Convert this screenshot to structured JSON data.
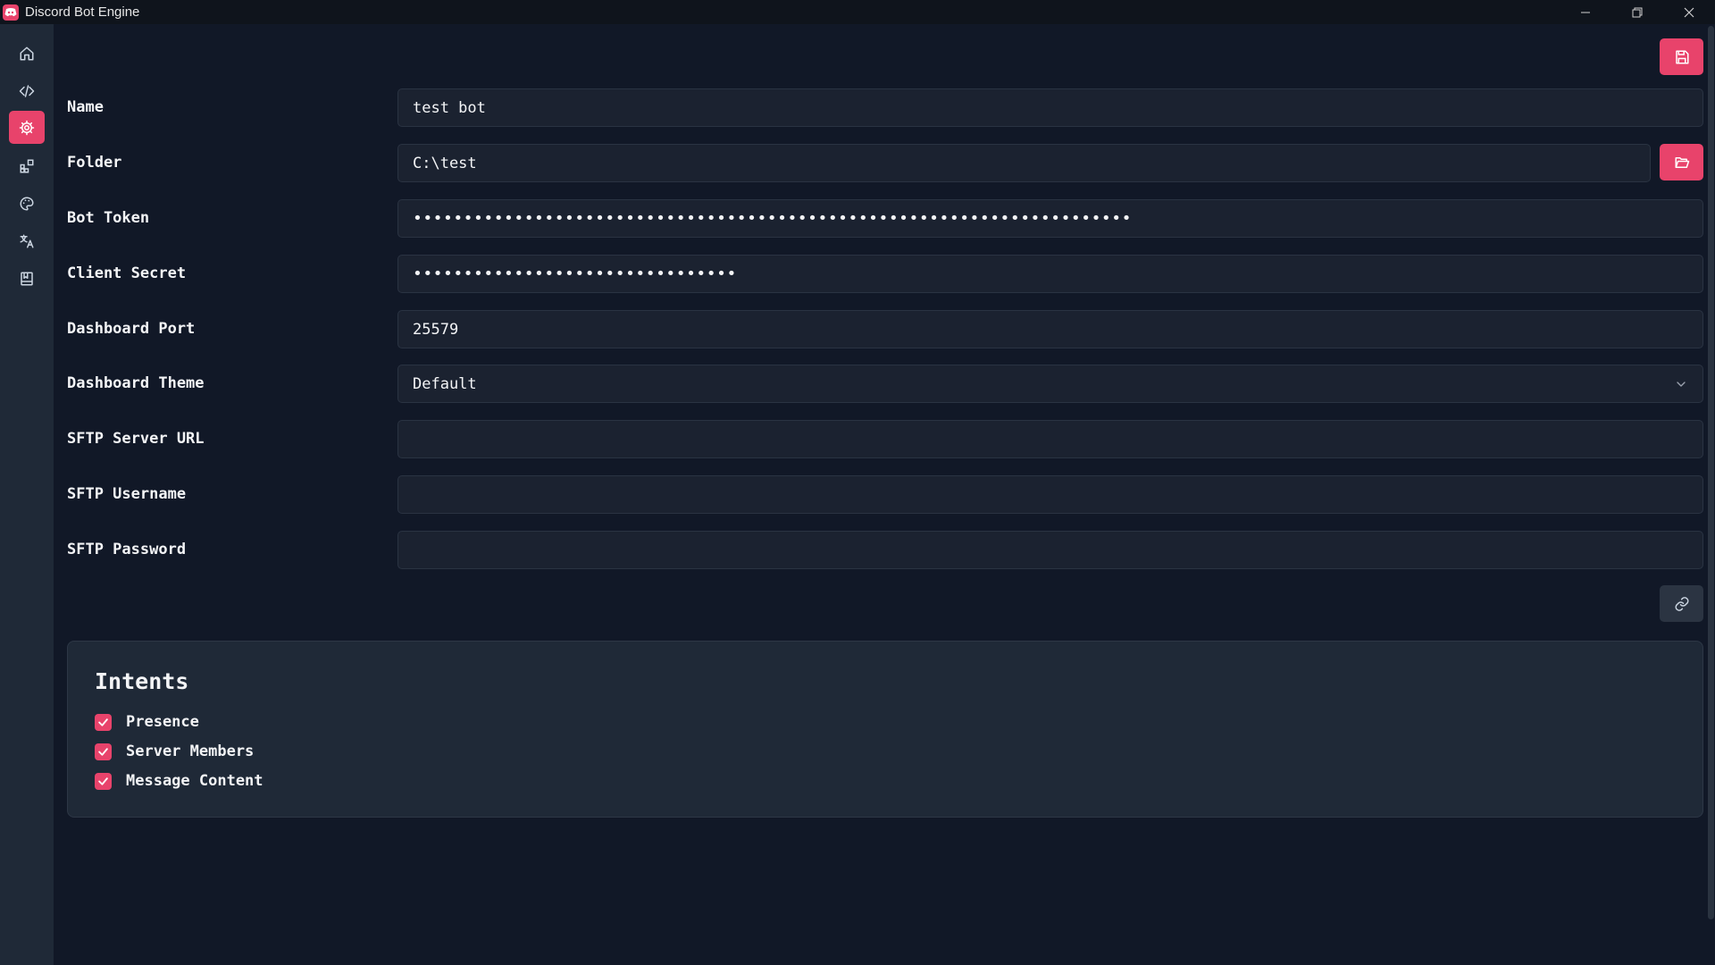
{
  "window": {
    "title": "Discord Bot Engine"
  },
  "sidebar": {
    "items": [
      {
        "icon": "home-icon",
        "active": false
      },
      {
        "icon": "code-icon",
        "active": false
      },
      {
        "icon": "gear-icon",
        "active": true
      },
      {
        "icon": "plugins-icon",
        "active": false
      },
      {
        "icon": "palette-icon",
        "active": false
      },
      {
        "icon": "translate-icon",
        "active": false
      },
      {
        "icon": "book-icon",
        "active": false
      }
    ]
  },
  "toolbar": {
    "save_icon": "save-icon"
  },
  "form": {
    "name": {
      "label": "Name",
      "value": "test bot"
    },
    "folder": {
      "label": "Folder",
      "value": "C:\\test"
    },
    "bot_token": {
      "label": "Bot Token",
      "value": "•••••••••••••••••••••••••••••••••••••••••••••••••••••••••••••••••••••••"
    },
    "client_secret": {
      "label": "Client Secret",
      "value": "••••••••••••••••••••••••••••••••"
    },
    "dashboard_port": {
      "label": "Dashboard Port",
      "value": "25579"
    },
    "dashboard_theme": {
      "label": "Dashboard Theme",
      "value": "Default"
    },
    "sftp_url": {
      "label": "SFTP Server URL",
      "value": ""
    },
    "sftp_username": {
      "label": "SFTP Username",
      "value": ""
    },
    "sftp_password": {
      "label": "SFTP Password",
      "value": ""
    }
  },
  "intents": {
    "title": "Intents",
    "items": [
      {
        "label": "Presence",
        "checked": true
      },
      {
        "label": "Server Members",
        "checked": true
      },
      {
        "label": "Message Content",
        "checked": true
      }
    ]
  },
  "colors": {
    "accent": "#e8436b",
    "background": "#111827",
    "sidebar": "#1f2937",
    "input": "#1b2230"
  }
}
